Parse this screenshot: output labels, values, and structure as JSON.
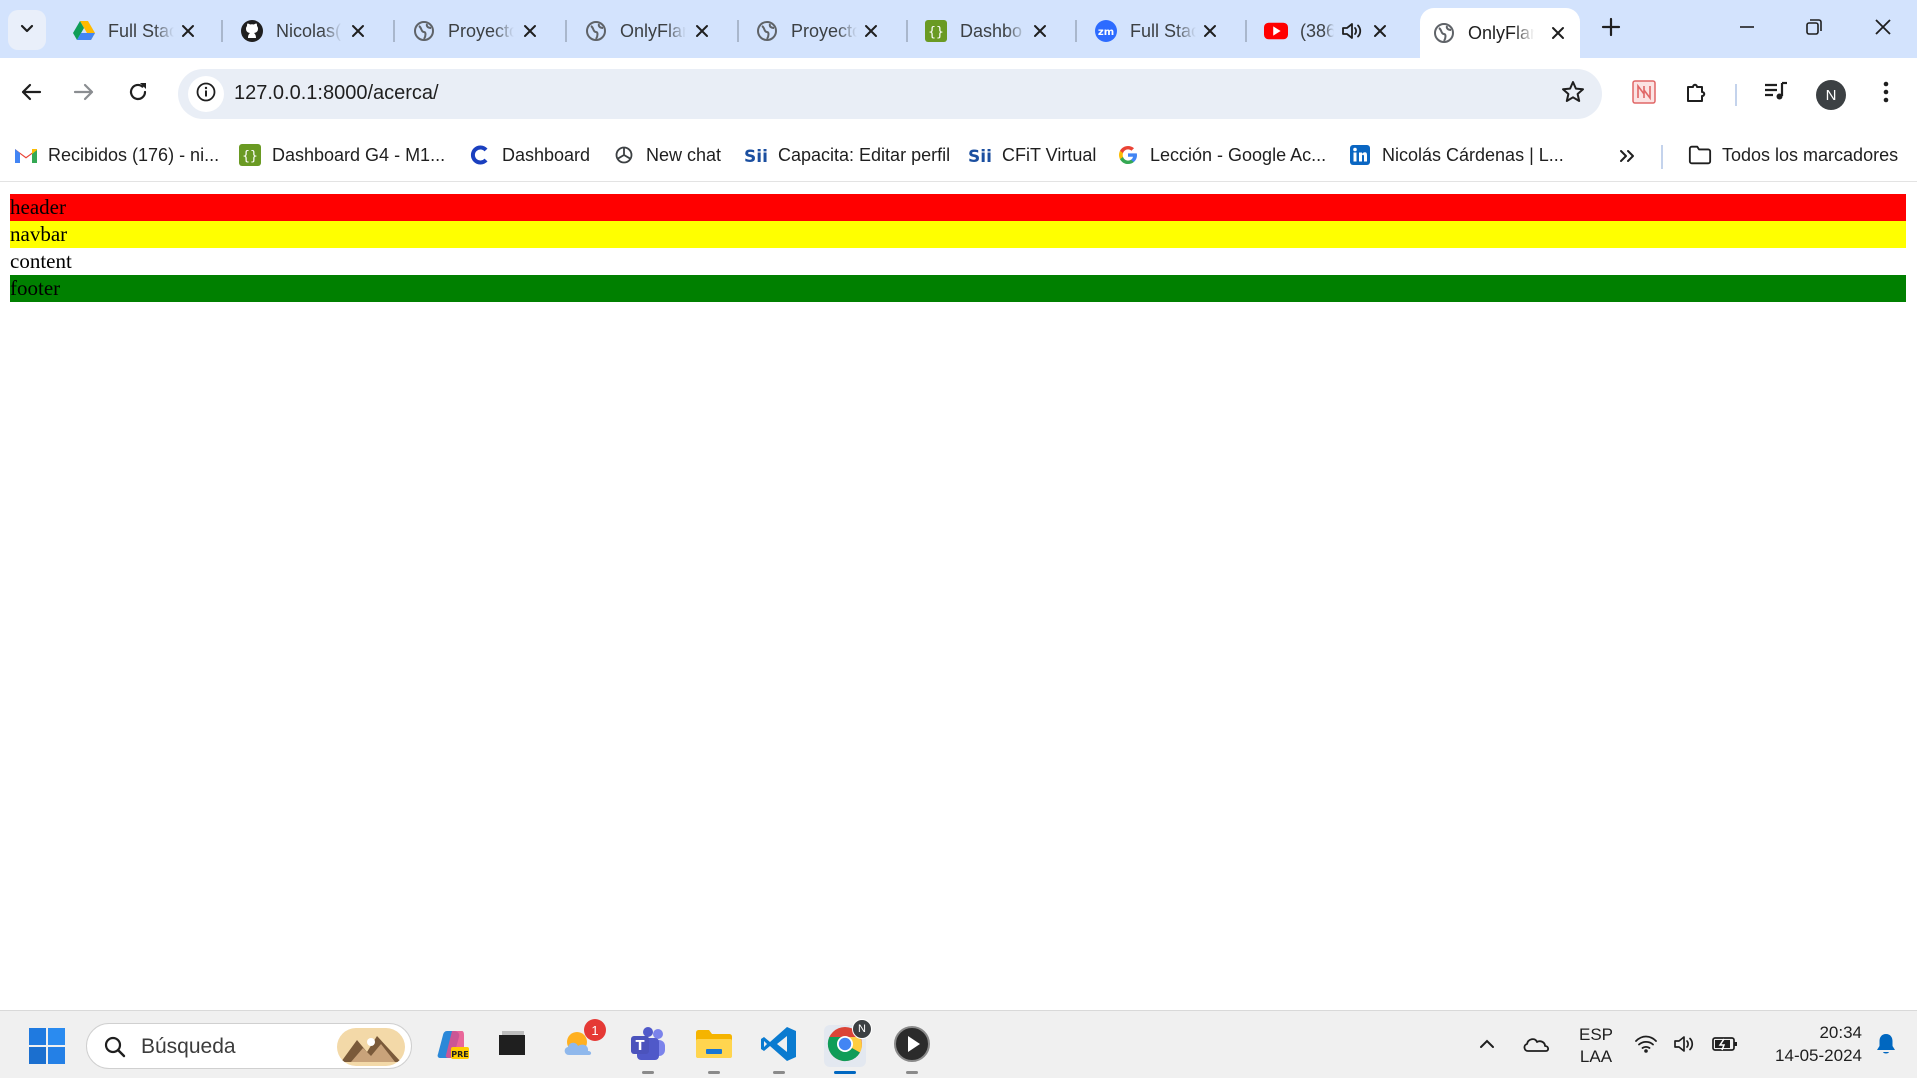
{
  "browser": {
    "tabs": [
      {
        "title": "Full Stac",
        "icon": "google-drive-icon"
      },
      {
        "title": "Nicolas(",
        "icon": "github-icon"
      },
      {
        "title": "Proyecto",
        "icon": "globe-icon"
      },
      {
        "title": "OnlyFlan",
        "icon": "globe-icon"
      },
      {
        "title": "Proyecto",
        "icon": "globe-icon"
      },
      {
        "title": "Dashbo",
        "icon": "json-icon"
      },
      {
        "title": "Full Stac",
        "icon": "zoom-icon"
      },
      {
        "title": "(386",
        "icon": "youtube-icon"
      },
      {
        "title": "OnlyFlan",
        "icon": "globe-icon",
        "active": true
      }
    ],
    "url": "127.0.0.1:8000/acerca/",
    "avatar_initial": "N",
    "bookmarks": [
      {
        "label": "Recibidos (176) - ni...",
        "icon": "gmail-icon"
      },
      {
        "label": "Dashboard G4 - M1...",
        "icon": "json-icon"
      },
      {
        "label": "Dashboard",
        "icon": "c-logo-icon"
      },
      {
        "label": "New chat",
        "icon": "openai-icon"
      },
      {
        "label": "Capacita: Editar perfil",
        "icon": "sii-icon"
      },
      {
        "label": "CFiT Virtual",
        "icon": "sii-icon"
      },
      {
        "label": "Lección - Google Ac...",
        "icon": "google-icon"
      },
      {
        "label": "Nicolás Cárdenas | L...",
        "icon": "linkedin-icon"
      }
    ],
    "all_bookmarks_label": "Todos los marcadores"
  },
  "page": {
    "sections": [
      {
        "label": "header",
        "color": "#ff0000"
      },
      {
        "label": "navbar",
        "color": "#ffff00"
      },
      {
        "label": "content",
        "color": "#ffffff"
      },
      {
        "label": "footer",
        "color": "#008000"
      }
    ]
  },
  "taskbar": {
    "search_placeholder": "Búsqueda",
    "notification_count": "1",
    "chrome_badge": "N",
    "language": "ESP",
    "keyboard": "LAA",
    "time": "20:34",
    "date": "14-05-2024"
  }
}
